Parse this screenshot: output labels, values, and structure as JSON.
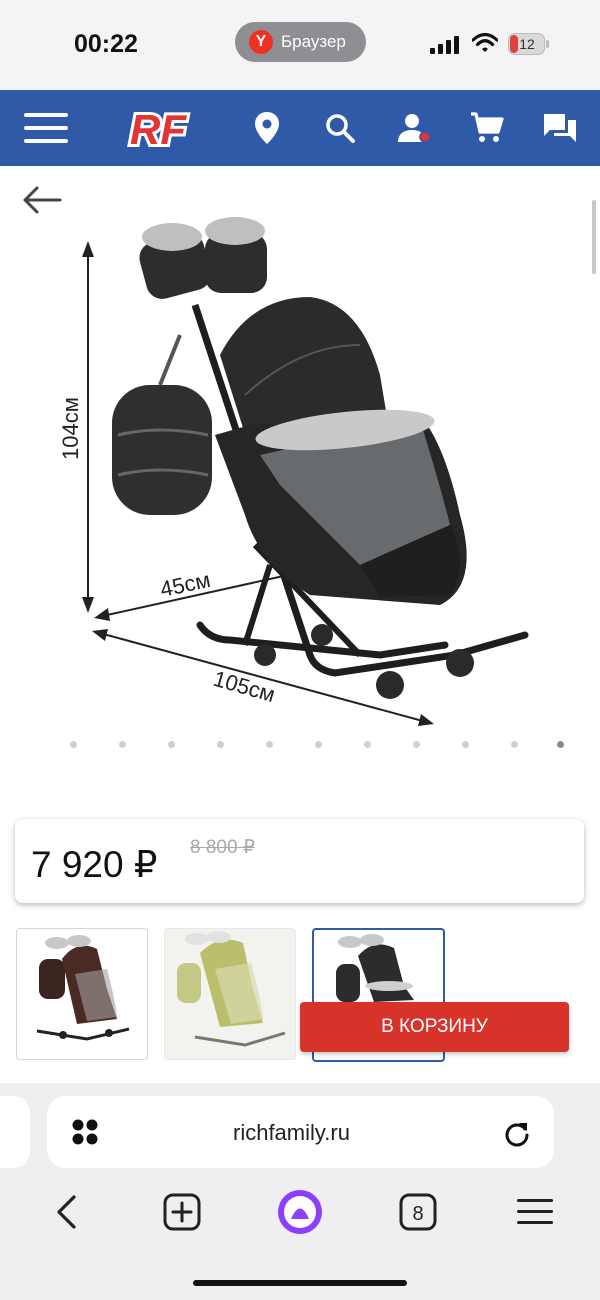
{
  "status_bar": {
    "time": "00:22",
    "browser_label": "Браузер",
    "browser_logo_letter": "Y",
    "battery_level": "12"
  },
  "header": {
    "logo_text": "RF",
    "brand_color": "#2e5aa8",
    "logo_color": "#e53232",
    "icons": [
      "menu-icon",
      "location-pin-icon",
      "search-icon",
      "user-icon",
      "cart-icon",
      "chat-icon"
    ]
  },
  "product": {
    "dimension_height": "104см",
    "dimension_width": "45см",
    "dimension_length": "105см",
    "gallery_dot_count": 11,
    "gallery_active_index": 10
  },
  "price": {
    "current": "7 920 ₽",
    "old": "8 800 ₽"
  },
  "thumbnails": [
    {
      "variant": "brown",
      "color": "#4a2a22"
    },
    {
      "variant": "olive",
      "color": "#b9bf6a"
    },
    {
      "variant": "black",
      "color": "#2c2c2c"
    }
  ],
  "cart_button": {
    "label": "В КОРЗИНУ",
    "color": "#d7332b"
  },
  "browser": {
    "url": "richfamily.ru",
    "tab_count": "8",
    "alice_color": "#8a3ffc"
  }
}
